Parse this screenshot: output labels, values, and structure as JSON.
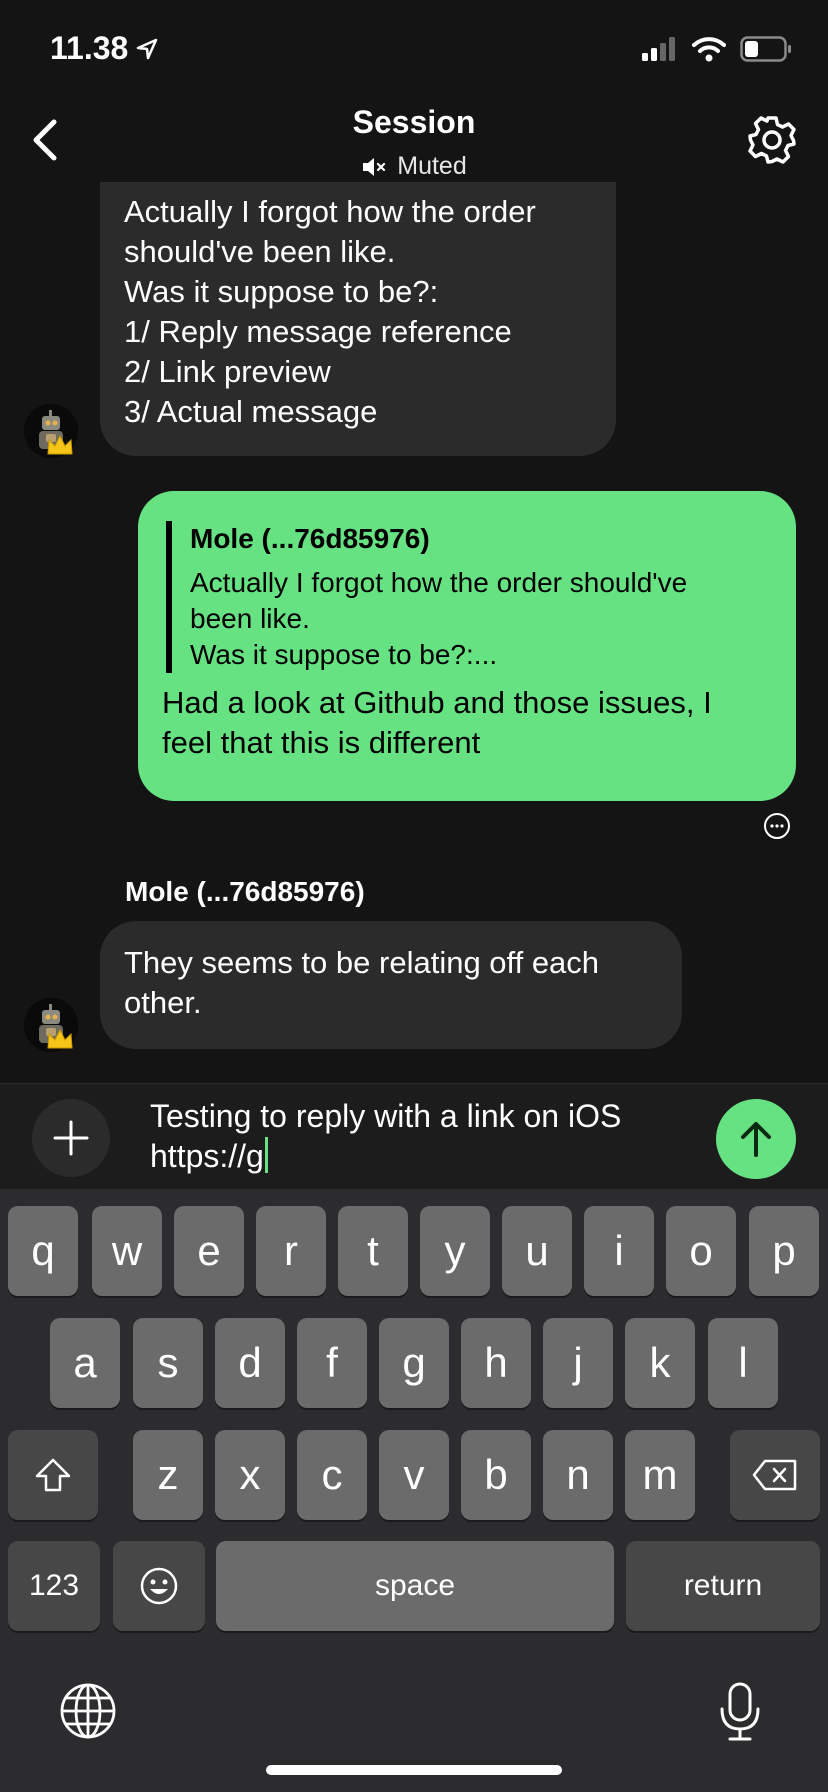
{
  "status_bar": {
    "time": "11.38"
  },
  "header": {
    "title": "Session",
    "subtitle": "Muted"
  },
  "messages": [
    {
      "direction": "incoming",
      "lines": [
        "Actually I forgot how the order",
        "should've been like.",
        "Was it suppose to be?:",
        "1/ Reply message reference",
        "2/ Link preview",
        "3/ Actual message"
      ]
    },
    {
      "direction": "outgoing",
      "quote_author": "Mole (...76d85976)",
      "quote_lines": [
        "Actually I forgot how the order should've",
        "been like.",
        "Was it suppose to be?:..."
      ],
      "lines": [
        "Had a look at Github and those issues, I",
        "feel that this is different"
      ]
    },
    {
      "direction": "incoming",
      "sender": "Mole (...76d85976)",
      "lines": [
        "They seems to be relating off each",
        "other."
      ]
    }
  ],
  "composer": {
    "lines": [
      "Testing to reply with a link on iOS",
      "https://g"
    ]
  },
  "keyboard": {
    "row1": [
      "q",
      "w",
      "e",
      "r",
      "t",
      "y",
      "u",
      "i",
      "o",
      "p"
    ],
    "row2": [
      "a",
      "s",
      "d",
      "f",
      "g",
      "h",
      "j",
      "k",
      "l"
    ],
    "row3": [
      "z",
      "x",
      "c",
      "v",
      "b",
      "n",
      "m"
    ],
    "numbers_label": "123",
    "space_label": "space",
    "return_label": "return"
  },
  "colors": {
    "accent": "#66e282",
    "background": "#141414",
    "incoming_bubble": "#2b2b2b"
  }
}
